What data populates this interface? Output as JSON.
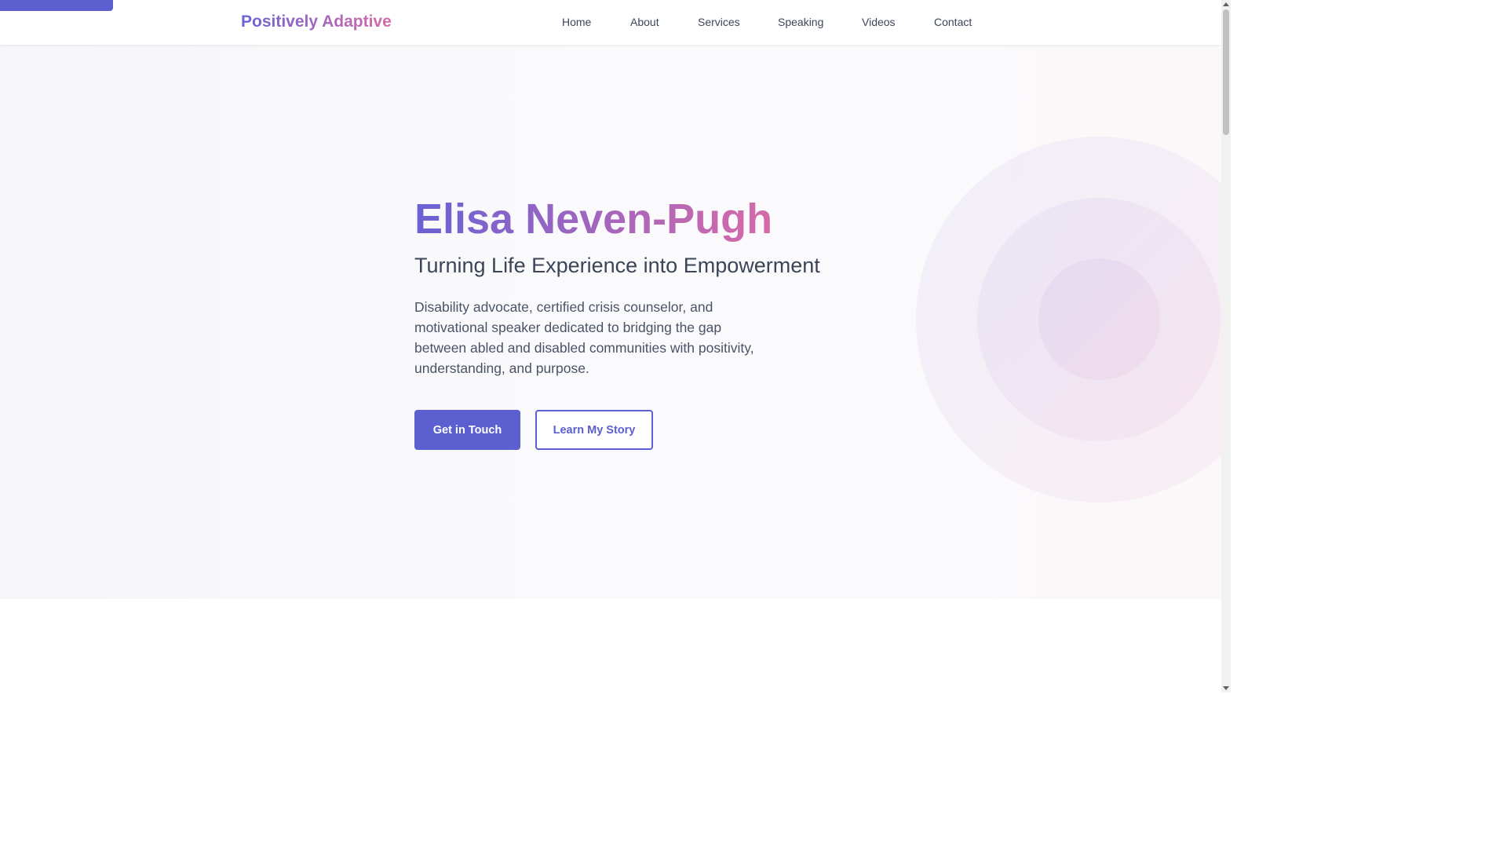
{
  "nav": {
    "logo": "Positively Adaptive",
    "links": [
      "Home",
      "About",
      "Services",
      "Speaking",
      "Videos",
      "Contact"
    ]
  },
  "hero": {
    "title": "Elisa Neven-Pugh",
    "subtitle": "Turning Life Experience into Empowerment",
    "description": "Disability advocate, certified crisis counselor, and motivational speaker dedicated to bridging the gap between abled and disabled communities with positivity, understanding, and purpose.",
    "primary_button": "Get in Touch",
    "secondary_button": "Learn My Story"
  },
  "colors": {
    "accent": "#5b5fd0",
    "gradient_start": "#6a62d4",
    "gradient_end": "#d76aa8",
    "text": "#3c4558"
  }
}
